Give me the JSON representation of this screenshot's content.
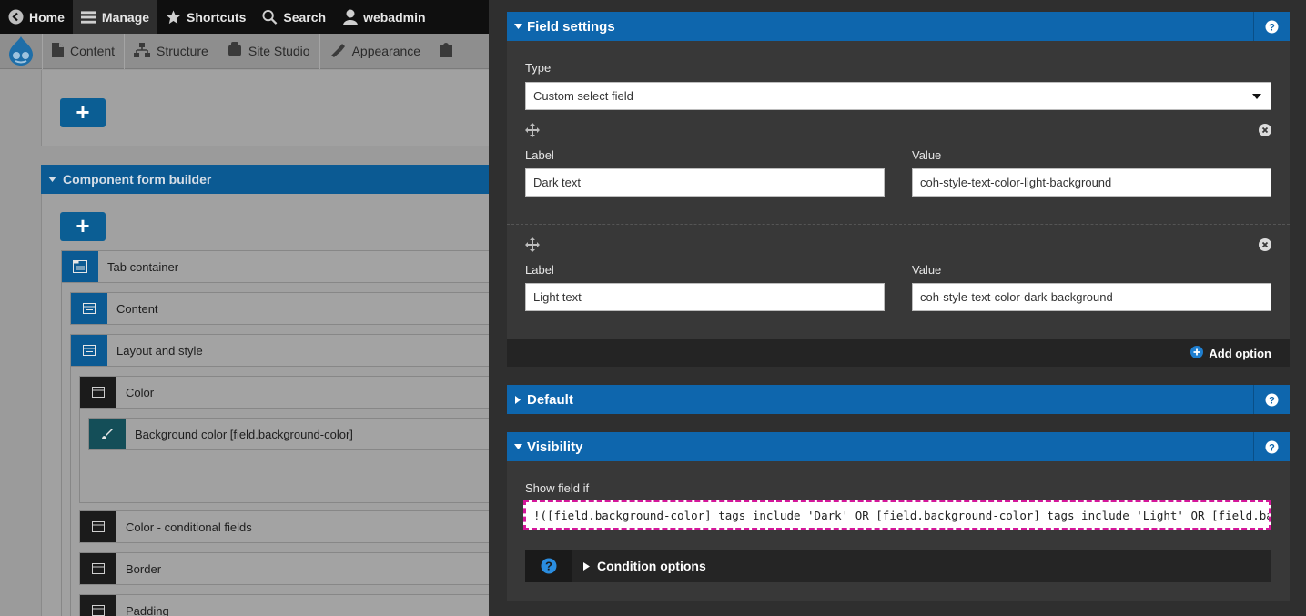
{
  "toolbar": {
    "home": "Home",
    "manage": "Manage",
    "shortcuts": "Shortcuts",
    "search": "Search",
    "user": "webadmin"
  },
  "subnav": {
    "content": "Content",
    "structure": "Structure",
    "site_studio": "Site Studio",
    "appearance": "Appearance"
  },
  "builder": {
    "title": "Component form builder",
    "add_label": "+",
    "items": [
      "Tab container",
      "Content",
      "Layout and style",
      "Color",
      "Background color [field.background-color]",
      "Color - conditional fields",
      "Border",
      "Padding"
    ]
  },
  "field_settings": {
    "title": "Field settings",
    "type_label": "Type",
    "type_value": "Custom select field",
    "options": [
      {
        "label_caption": "Label",
        "label_value": "Dark text",
        "value_caption": "Value",
        "value_value": "coh-style-text-color-light-background"
      },
      {
        "label_caption": "Label",
        "label_value": "Light text",
        "value_caption": "Value",
        "value_value": "coh-style-text-color-dark-background"
      }
    ],
    "add_option": "Add option"
  },
  "default_section": {
    "title": "Default"
  },
  "visibility": {
    "title": "Visibility",
    "show_field_label": "Show field if",
    "condition_value": "!([field.background-color] tags include 'Dark' OR [field.background-color] tags include 'Light' OR [field.background-color] tags include",
    "condition_options": "Condition options"
  },
  "colors": {
    "accent": "#0e66ad",
    "highlight": "#d4169a",
    "panel": "#2f2f2f"
  }
}
